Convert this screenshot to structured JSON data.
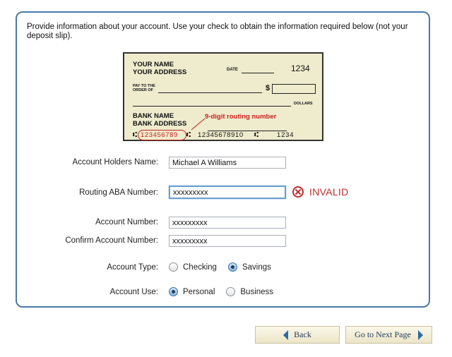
{
  "intro_text": "Provide information about your account. Use your check to obtain the information required below (not your deposit slip).",
  "check": {
    "name_line": "YOUR NAME",
    "address_line": "YOUR ADDRESS",
    "date_label": "DATE",
    "check_number": "1234",
    "pay_to_line1": "PAY TO THE",
    "pay_to_line2": "ORDER OF",
    "currency_symbol": "$",
    "dollars_label": "DOLLARS",
    "bank_name": "BANK NAME",
    "bank_address": "BANK ADDRESS",
    "routing_annotation": "9-digit routing number",
    "micr_routing": "123456789",
    "micr_account": "12345678910",
    "micr_check": "1234",
    "micr_symbol": "⑆"
  },
  "form": {
    "account_holder": {
      "label": "Account Holders Name:",
      "value": "Michael A Williams"
    },
    "routing": {
      "label": "Routing ABA Number:",
      "value": "xxxxxxxxx"
    },
    "account_number": {
      "label": "Account Number:",
      "value": "xxxxxxxxx"
    },
    "confirm_account": {
      "label": "Confirm Account Number:",
      "value": "xxxxxxxxx"
    },
    "account_type": {
      "label": "Account Type:",
      "options": [
        "Checking",
        "Savings"
      ],
      "selected": "Savings"
    },
    "account_use": {
      "label": "Account Use:",
      "options": [
        "Personal",
        "Business"
      ],
      "selected": "Personal"
    }
  },
  "validation": {
    "routing_error": "INVALID",
    "error_color": "#c42a2a"
  },
  "nav": {
    "back_label": "Back",
    "next_label": "Go to Next Page"
  },
  "colors": {
    "panel_border": "#4a7aa8",
    "check_bg": "#eeeccd",
    "accent": "#2a6aa8"
  }
}
